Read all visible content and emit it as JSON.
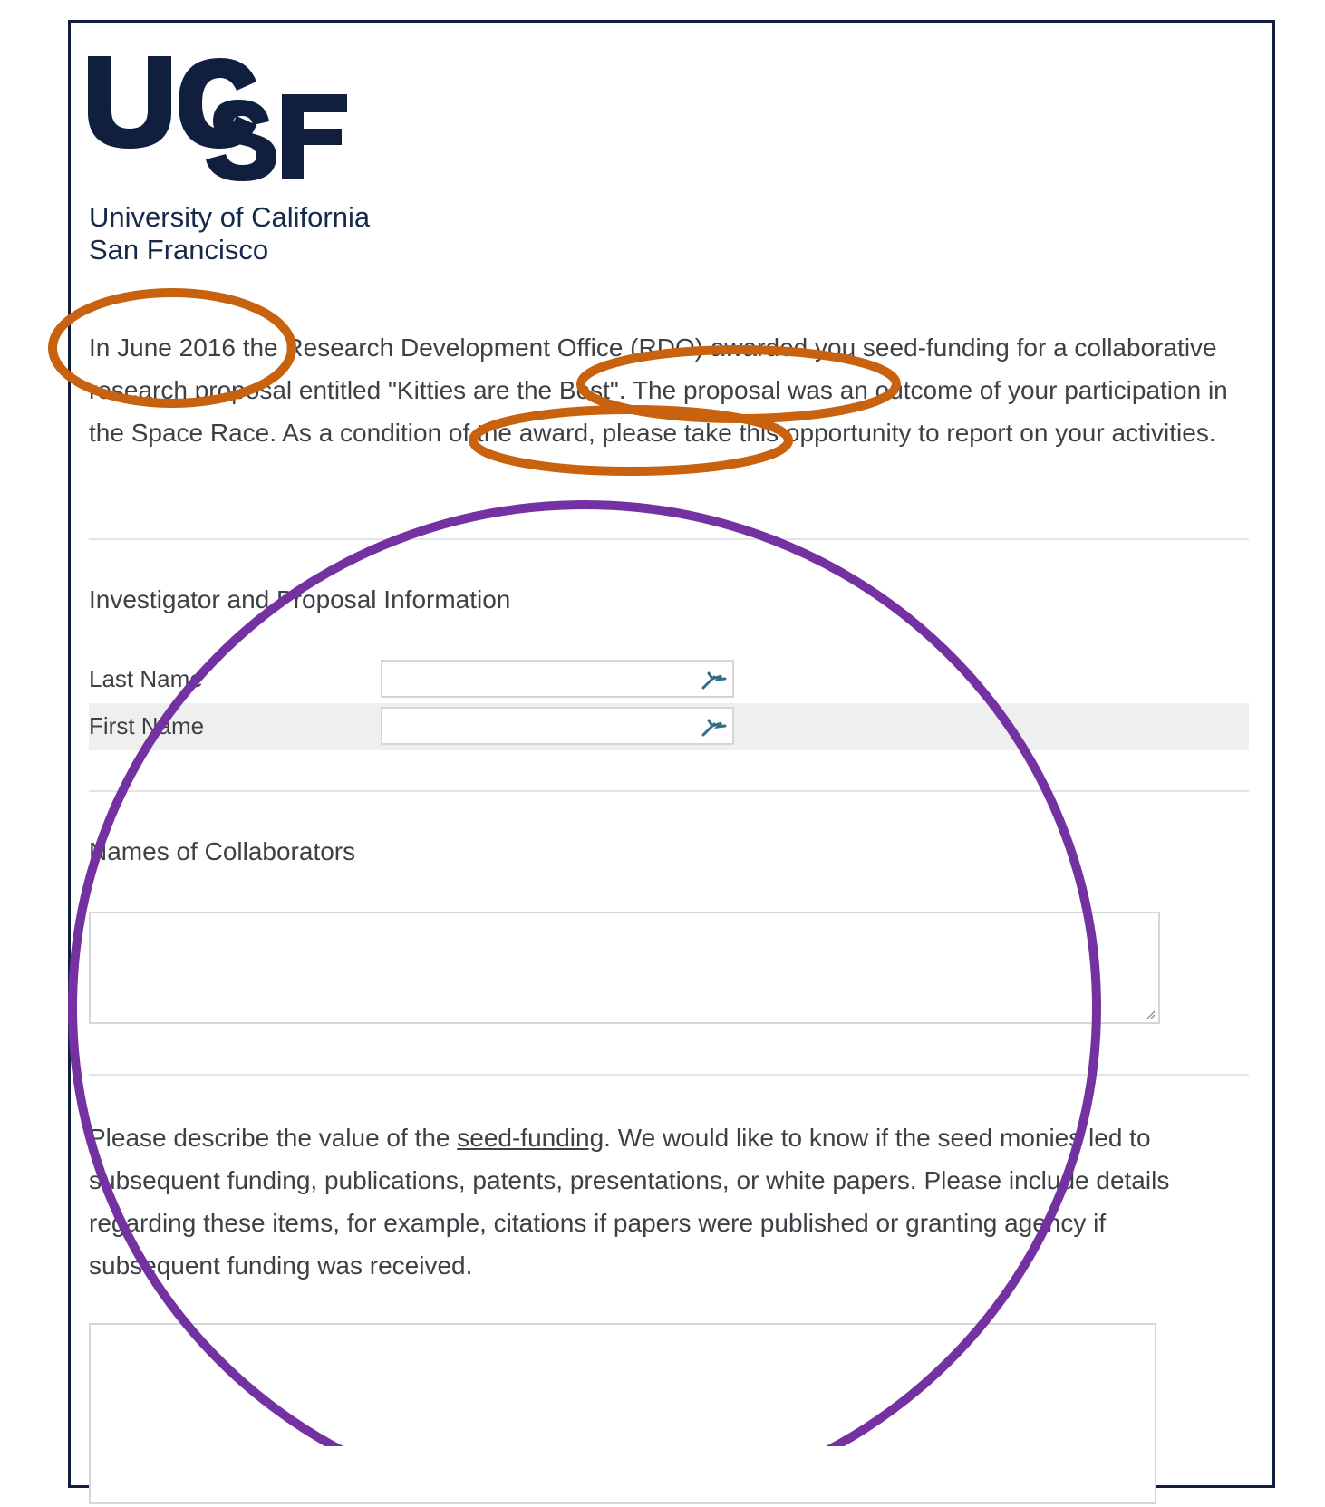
{
  "logo": {
    "wordmark": "UCSF",
    "icon_name": "ucsf-logo"
  },
  "university": {
    "line1": "University of California",
    "line2": "San Francisco"
  },
  "intro": {
    "text_1": "In June 2016 the Research Development Office (RDO) awarded you seed-funding for a collaborative research proposal entitled ",
    "title": "\"Kitties are the Best\"",
    "text_2": ". The proposal was an outcome of your participation in the Space Race. As a condition of the award, please take this opportunity to report on your activities."
  },
  "section_investigator": {
    "title": "Investigator and Proposal Information",
    "fields": [
      {
        "label": "Last Name",
        "value": ""
      },
      {
        "label": "First Name",
        "value": ""
      }
    ]
  },
  "section_collaborators": {
    "title": "Names of Collaborators",
    "value": ""
  },
  "section_value": {
    "text_1": "Please describe the value of the ",
    "link": "seed-funding",
    "text_2": ". We would like to know if the seed monies led to subsequent funding, publications, patents, presentations, or white papers. Please include details regarding these items, for example, citations if papers were published or granting agency if subsequent funding was received.",
    "value": ""
  },
  "annotations": {
    "orange_color": "#c8620f",
    "purple_color": "#7431a1"
  }
}
